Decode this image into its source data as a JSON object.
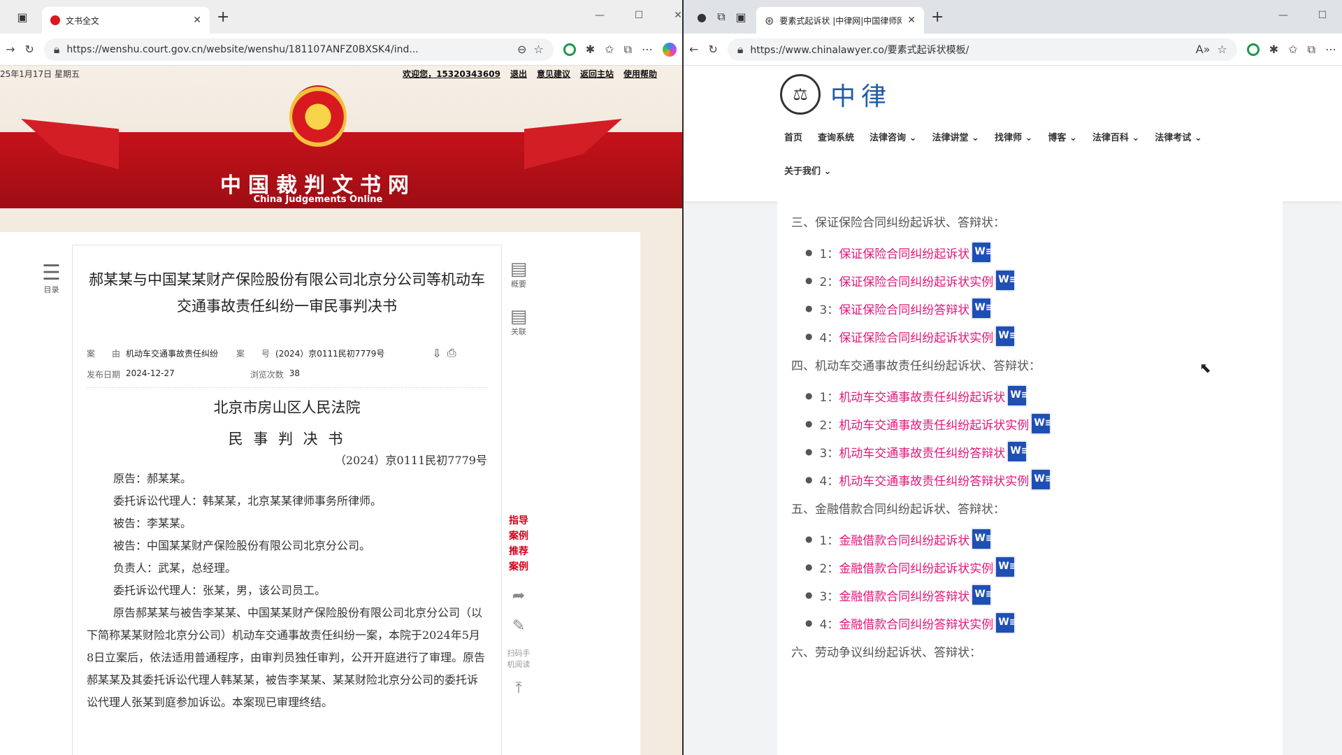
{
  "left_browser": {
    "tab_title": "文书全文",
    "url": "https://wenshu.court.gov.cn/website/wenshu/181107ANFZ0BXSK4/ind...",
    "date_text": "25年1月17日 星期五",
    "topbar_links": [
      "欢迎您，15320343609",
      "退出",
      "意见建议",
      "返回主站",
      "使用帮助"
    ],
    "site_title": "中国裁判文书网",
    "site_subtitle": "China Judgements Online",
    "toc_label": "目录",
    "doc_title": "郝某某与中国某某财产保险股份有限公司北京分公司等机动车交通事故责任纠纷一审民事判决书",
    "cause_label": "案　　由",
    "cause_value": "机动车交通事故责任纠纷",
    "caseno_label": "案　　号",
    "caseno_value": "(2024）京0111民初7779号",
    "pub_label": "发布日期",
    "pub_value": "2024-12-27",
    "views_label": "浏览次数",
    "views_value": "38",
    "court": "北京市房山区人民法院",
    "doc_type": "民 事 判 决 书",
    "doc_caseno": "（2024）京0111民初7779号",
    "paras": [
      "原告：郝某某。",
      "委托诉讼代理人：韩某某，北京某某律师事务所律师。",
      "被告：李某某。",
      "被告：中国某某财产保险股份有限公司北京分公司。",
      "负责人：武某，总经理。",
      "委托诉讼代理人：张某，男，该公司员工。"
    ],
    "body": "原告郝某某与被告李某某、中国某某财产保险股份有限公司北京分公司（以下简称某某财险北京分公司）机动车交通事故责任纠纷一案，本院于2024年5月8日立案后，依法适用普通程序，由审判员独任审判，公开开庭进行了审理。原告郝某某及其委托诉讼代理人韩某某，被告李某某、某某财险北京分公司的委托诉讼代理人张某到庭参加诉讼。本案现已审理终结。",
    "side_items": [
      "概要",
      "关联"
    ],
    "red_links": [
      "指导",
      "案例",
      "推荐",
      "案例"
    ],
    "scan_label": "扫码手机阅读"
  },
  "right_browser": {
    "tab_title": "要素式起诉状 |中律网|中国律师网|中",
    "url": "https://www.chinalawyer.co/要素式起诉状模板/",
    "logo_text": "中律",
    "nav": [
      "首页",
      "查询系统",
      "法律咨询",
      "法律讲堂",
      "找律师",
      "博客",
      "法律百科",
      "法律考试"
    ],
    "nav_second": "关于我们",
    "sections": [
      {
        "title": "三、保证保险合同纠纷起诉状、答辩状：",
        "items": [
          {
            "num": "1：",
            "text": "保证保险合同纠纷起诉状"
          },
          {
            "num": "2：",
            "text": "保证保险合同纠纷起诉状实例"
          },
          {
            "num": "3：",
            "text": "保证保险合同纠纷答辩状"
          },
          {
            "num": "4：",
            "text": "保证保险合同纠纷起诉状实例"
          }
        ]
      },
      {
        "title": "四、机动车交通事故责任纠纷起诉状、答辩状：",
        "items": [
          {
            "num": "1：",
            "text": "机动车交通事故责任纠纷起诉状"
          },
          {
            "num": "2：",
            "text": "机动车交通事故责任纠纷起诉状实例"
          },
          {
            "num": "3：",
            "text": "机动车交通事故责任纠纷答辩状"
          },
          {
            "num": "4：",
            "text": "机动车交通事故责任纠纷答辩状实例"
          }
        ]
      },
      {
        "title": "五、金融借款合同纠纷起诉状、答辩状：",
        "items": [
          {
            "num": "1：",
            "text": "金融借款合同纠纷起诉状"
          },
          {
            "num": "2：",
            "text": "金融借款合同纠纷起诉状实例"
          },
          {
            "num": "3：",
            "text": "金融借款合同纠纷答辩状"
          },
          {
            "num": "4：",
            "text": "金融借款合同纠纷答辩状实例"
          }
        ]
      },
      {
        "title": "六、劳动争议纠纷起诉状、答辩状：",
        "items": []
      }
    ],
    "word_icon_text": "W≡"
  }
}
